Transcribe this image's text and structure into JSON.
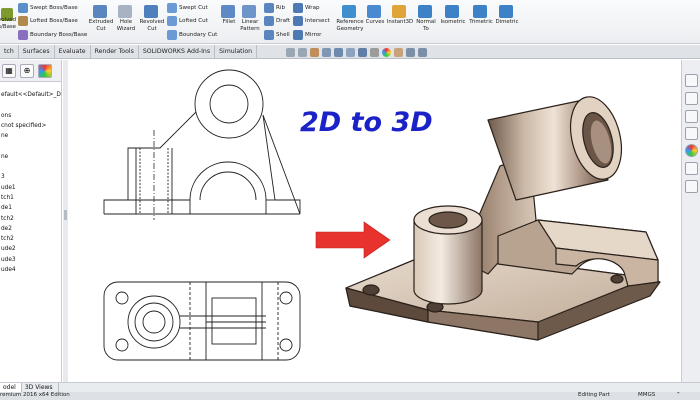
{
  "ribbon": {
    "buttons_big": [
      {
        "name": "extruded-boss-button",
        "label": "Extruded Boss/Base",
        "icon": "extrude-icon"
      },
      {
        "name": "extruded-cut-button",
        "label": "Extruded Cut",
        "icon": "extrude-cut-icon"
      },
      {
        "name": "hole-wizard-button",
        "label": "Hole Wizard",
        "icon": "hole-wizard-icon"
      },
      {
        "name": "revolved-cut-button",
        "label": "Revolved Cut",
        "icon": "revolve-cut-icon"
      },
      {
        "name": "fillet-button",
        "label": "Fillet",
        "icon": "fillet-icon"
      },
      {
        "name": "linear-pattern-button",
        "label": "Linear Pattern",
        "icon": "linear-pattern-icon"
      },
      {
        "name": "reference-geometry-button",
        "label": "Reference Geometry",
        "icon": "reference-geometry-icon"
      },
      {
        "name": "curves-button",
        "label": "Curves",
        "icon": "curves-icon"
      },
      {
        "name": "instant3d-button",
        "label": "Instant3D",
        "icon": "instant3d-icon"
      },
      {
        "name": "normal-to-button",
        "label": "Normal To",
        "icon": "normal-to-icon"
      },
      {
        "name": "isometric-button",
        "label": "Isometric",
        "icon": "isometric-icon"
      },
      {
        "name": "trimetric-button",
        "label": "Trimetric",
        "icon": "trimetric-icon"
      },
      {
        "name": "dimetric-button",
        "label": "Dimetric",
        "icon": "dimetric-icon"
      }
    ],
    "boss_big_label": "Revolved Boss/Base",
    "buttons_small": {
      "swept_boss": "Swept Boss/Base",
      "lofted_boss": "Lofted Boss/Base",
      "boundary_boss": "Boundary Boss/Base",
      "swept_cut": "Swept Cut",
      "lofted_cut": "Lofted Cut",
      "boundary_cut": "Boundary Cut",
      "rib": "Rib",
      "draft": "Draft",
      "shell": "Shell",
      "wrap": "Wrap",
      "intersect": "Intersect",
      "mirror": "Mirror"
    }
  },
  "command_tabs": [
    "tch",
    "Surfaces",
    "Evaluate",
    "Render Tools",
    "SOLIDWORKS Add-Ins",
    "Simulation"
  ],
  "feature_tree": {
    "items": [
      "efault<<Default>_Dis",
      "",
      "ons",
      "cnot specified>",
      "ne",
      "",
      "ne",
      "",
      "3",
      "ude1",
      "tch1",
      "de1",
      "tch2",
      "de2",
      "tch2",
      "ude2",
      "ude3",
      "ude4"
    ]
  },
  "canvas": {
    "headline": "2D to 3D"
  },
  "bottom_tabs": [
    "odel",
    "3D Views"
  ],
  "status_bar": {
    "edition": "remium 2016 x64 Edition",
    "mode": "Editing Part",
    "units": "MMGS"
  },
  "colors": {
    "headline": "#1a22c8",
    "arrow": "#e8322e",
    "part_body": "#c9b7a6",
    "part_shadow": "#6e5a4b"
  }
}
